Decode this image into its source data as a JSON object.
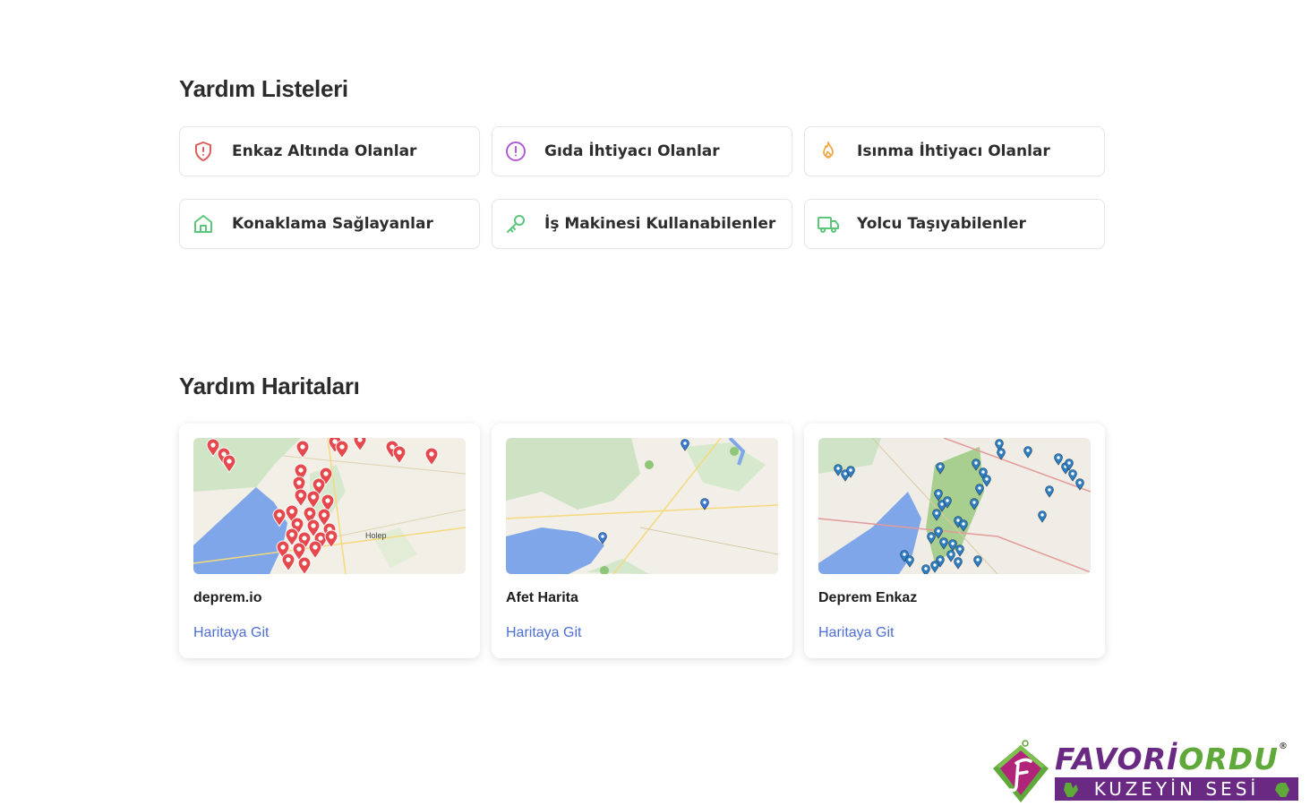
{
  "lists": {
    "title": "Yardım Listeleri",
    "items": [
      {
        "label": "Enkaz Altında Olanlar",
        "icon": "shield-alert-icon",
        "color": "#e05a5a"
      },
      {
        "label": "Gıda İhtiyacı Olanlar",
        "icon": "alert-circle-icon",
        "color": "#b45ad6"
      },
      {
        "label": "Isınma İhtiyacı Olanlar",
        "icon": "flame-icon",
        "color": "#f0a94a"
      },
      {
        "label": "Konaklama Sağlayanlar",
        "icon": "home-icon",
        "color": "#5cc77a"
      },
      {
        "label": "İş Makinesi Kullanabilenler",
        "icon": "key-icon",
        "color": "#5cc77a"
      },
      {
        "label": "Yolcu Taşıyabilenler",
        "icon": "truck-icon",
        "color": "#5cc77a"
      }
    ]
  },
  "maps": {
    "title": "Yardım Haritaları",
    "cards": [
      {
        "title": "deprem.io",
        "link": "Haritaya Git",
        "marker_color": "#e5484d"
      },
      {
        "title": "Afet Harita",
        "link": "Haritaya Git",
        "marker_color": "#3a7bd5"
      },
      {
        "title": "Deprem Enkaz",
        "link": "Haritaya Git",
        "marker_color": "#2f7fc1"
      }
    ],
    "labels": {
      "holep": "Holep"
    }
  },
  "logo": {
    "name_part1": "FAVORİ",
    "name_part2": "ORDU",
    "tagline": "KUZEYİN SESİ",
    "color_green": "#5fa93a",
    "color_purple": "#6a2a83"
  }
}
